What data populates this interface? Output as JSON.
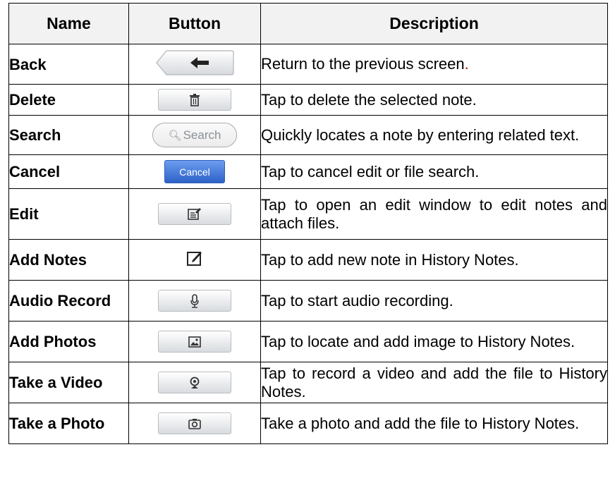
{
  "header": {
    "name": "Name",
    "button": "Button",
    "description": "Description"
  },
  "rows": [
    {
      "name": "Back",
      "icon": "back-arrow-icon",
      "description": "Return to the previous screen",
      "description_suffix": "."
    },
    {
      "name": "Delete",
      "icon": "trash-icon",
      "description": "Tap to delete the selected note."
    },
    {
      "name": "Search",
      "icon": "search-icon",
      "button_text": "Search",
      "description": "Quickly locates a note by entering related text."
    },
    {
      "name": "Cancel",
      "icon": "cancel-button",
      "button_text": "Cancel",
      "description": "Tap to cancel edit or file search."
    },
    {
      "name": "Edit",
      "icon": "edit-icon",
      "description": "Tap to open an edit window to edit notes and attach files."
    },
    {
      "name": "Add Notes",
      "icon": "compose-icon",
      "description": "Tap to add new note in History Notes."
    },
    {
      "name": "Audio Record",
      "icon": "microphone-icon",
      "description": "Tap to start audio recording."
    },
    {
      "name": "Add Photos",
      "icon": "image-icon",
      "description": "Tap to locate and add image to History Notes."
    },
    {
      "name": "Take a Video",
      "icon": "webcam-icon",
      "description": "Tap to record a video and add the file to History Notes."
    },
    {
      "name": "Take a Photo",
      "icon": "camera-icon",
      "description": "Take a photo and add the file to History Notes."
    }
  ],
  "colors": {
    "accent_red": "#c00000",
    "cancel_blue": "#2d62c8"
  }
}
